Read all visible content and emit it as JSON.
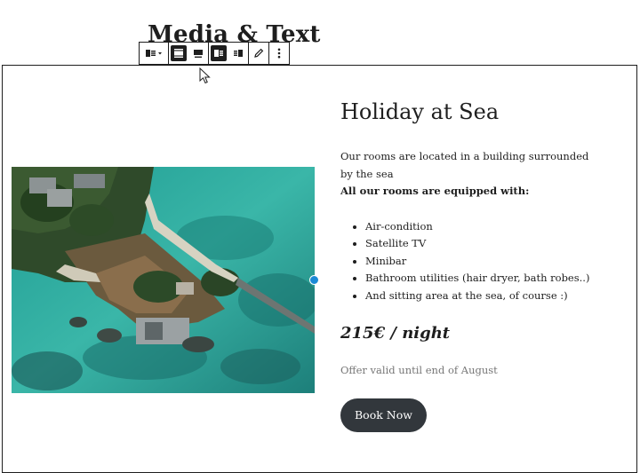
{
  "page": {
    "title": "Media & Text"
  },
  "toolbar": {
    "buttons": [
      {
        "icon": "block-type-icon",
        "active": false
      },
      {
        "icon": "align-wide-icon",
        "active": true
      },
      {
        "icon": "align-full-icon",
        "active": false
      },
      {
        "icon": "media-left-icon",
        "active": true
      },
      {
        "icon": "media-right-icon",
        "active": false
      },
      {
        "icon": "pencil-icon",
        "active": false
      },
      {
        "icon": "more-options-icon",
        "active": false
      }
    ]
  },
  "media": {
    "image_icon": "aerial-island-photo"
  },
  "content": {
    "heading": "Holiday at Sea",
    "description": "Our rooms are located in a building surrounded by the sea",
    "amenities_title": "All our rooms are equipped with:",
    "amenities": [
      "Air-condition",
      "Satellite TV",
      "Minibar",
      "Bathroom utilities (hair dryer, bath robes..)",
      "And sitting area at the sea, of course :)"
    ],
    "price": "215€ / night",
    "offer": "Offer valid until end of August",
    "button_label": "Book Now"
  },
  "colors": {
    "button_bg": "#32373c",
    "handle": "#1b8ad6",
    "muted_text": "#767676",
    "sea": "#2fa89c"
  }
}
